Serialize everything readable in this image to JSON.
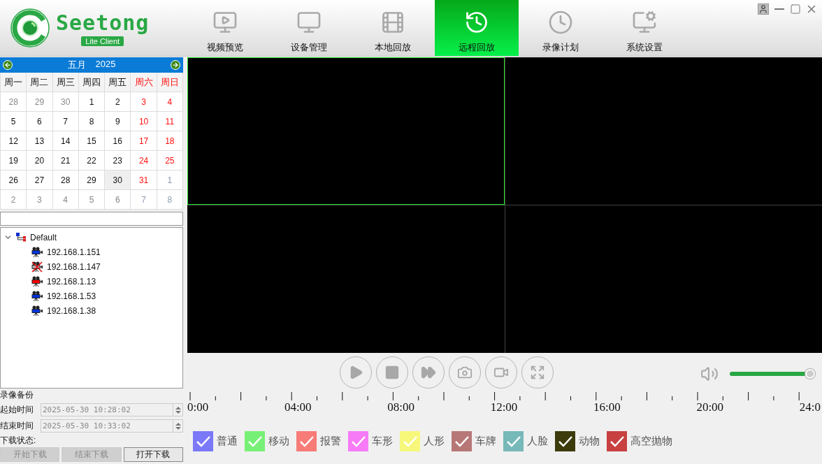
{
  "app": {
    "logo": "Seetong",
    "edition": "Lite Client"
  },
  "nav": [
    {
      "label": "视频预览",
      "selected": false
    },
    {
      "label": "设备管理",
      "selected": false
    },
    {
      "label": "本地回放",
      "selected": false
    },
    {
      "label": "远程回放",
      "selected": true
    },
    {
      "label": "录像计划",
      "selected": false
    },
    {
      "label": "系统设置",
      "selected": false
    }
  ],
  "calendar": {
    "month": "五月",
    "year": "2025",
    "weekdays": [
      {
        "label": "周一",
        "weekend": false
      },
      {
        "label": "周二",
        "weekend": false
      },
      {
        "label": "周三",
        "weekend": false
      },
      {
        "label": "周四",
        "weekend": false
      },
      {
        "label": "周五",
        "weekend": false
      },
      {
        "label": "周六",
        "weekend": true
      },
      {
        "label": "周日",
        "weekend": true
      }
    ],
    "days": [
      {
        "label": "28",
        "muted": true,
        "weekend": false,
        "selected": false
      },
      {
        "label": "29",
        "muted": true,
        "weekend": false,
        "selected": false
      },
      {
        "label": "30",
        "muted": true,
        "weekend": false,
        "selected": false
      },
      {
        "label": "1",
        "muted": false,
        "weekend": false,
        "selected": false
      },
      {
        "label": "2",
        "muted": false,
        "weekend": false,
        "selected": false
      },
      {
        "label": "3",
        "muted": false,
        "weekend": true,
        "selected": false
      },
      {
        "label": "4",
        "muted": false,
        "weekend": true,
        "selected": false
      },
      {
        "label": "5",
        "muted": false,
        "weekend": false,
        "selected": false
      },
      {
        "label": "6",
        "muted": false,
        "weekend": false,
        "selected": false
      },
      {
        "label": "7",
        "muted": false,
        "weekend": false,
        "selected": false
      },
      {
        "label": "8",
        "muted": false,
        "weekend": false,
        "selected": false
      },
      {
        "label": "9",
        "muted": false,
        "weekend": false,
        "selected": false
      },
      {
        "label": "10",
        "muted": false,
        "weekend": true,
        "selected": false
      },
      {
        "label": "11",
        "muted": false,
        "weekend": true,
        "selected": false
      },
      {
        "label": "12",
        "muted": false,
        "weekend": false,
        "selected": false
      },
      {
        "label": "13",
        "muted": false,
        "weekend": false,
        "selected": false
      },
      {
        "label": "14",
        "muted": false,
        "weekend": false,
        "selected": false
      },
      {
        "label": "15",
        "muted": false,
        "weekend": false,
        "selected": false
      },
      {
        "label": "16",
        "muted": false,
        "weekend": false,
        "selected": false
      },
      {
        "label": "17",
        "muted": false,
        "weekend": true,
        "selected": false
      },
      {
        "label": "18",
        "muted": false,
        "weekend": true,
        "selected": false
      },
      {
        "label": "19",
        "muted": false,
        "weekend": false,
        "selected": false
      },
      {
        "label": "20",
        "muted": false,
        "weekend": false,
        "selected": false
      },
      {
        "label": "21",
        "muted": false,
        "weekend": false,
        "selected": false
      },
      {
        "label": "22",
        "muted": false,
        "weekend": false,
        "selected": false
      },
      {
        "label": "23",
        "muted": false,
        "weekend": false,
        "selected": false
      },
      {
        "label": "24",
        "muted": false,
        "weekend": true,
        "selected": false
      },
      {
        "label": "25",
        "muted": false,
        "weekend": true,
        "selected": false
      },
      {
        "label": "26",
        "muted": false,
        "weekend": false,
        "selected": false
      },
      {
        "label": "27",
        "muted": false,
        "weekend": false,
        "selected": false
      },
      {
        "label": "28",
        "muted": false,
        "weekend": false,
        "selected": false
      },
      {
        "label": "29",
        "muted": false,
        "weekend": false,
        "selected": false
      },
      {
        "label": "30",
        "muted": false,
        "weekend": false,
        "selected": true
      },
      {
        "label": "31",
        "muted": false,
        "weekend": true,
        "selected": false
      },
      {
        "label": "1",
        "muted": true,
        "weekend": true,
        "selected": false
      },
      {
        "label": "2",
        "muted": true,
        "weekend": false,
        "selected": false
      },
      {
        "label": "3",
        "muted": true,
        "weekend": false,
        "selected": false
      },
      {
        "label": "4",
        "muted": true,
        "weekend": false,
        "selected": false
      },
      {
        "label": "5",
        "muted": true,
        "weekend": false,
        "selected": false
      },
      {
        "label": "6",
        "muted": true,
        "weekend": false,
        "selected": false
      },
      {
        "label": "7",
        "muted": true,
        "weekend": true,
        "selected": false
      },
      {
        "label": "8",
        "muted": true,
        "weekend": true,
        "selected": false
      }
    ]
  },
  "device_tree": [
    {
      "label": "Default",
      "expanded": true,
      "children": [
        {
          "label": "192.168.1.151",
          "kind": "online"
        },
        {
          "label": "192.168.1.147",
          "kind": "offline"
        },
        {
          "label": "192.168.1.13",
          "kind": "alarm"
        },
        {
          "label": "192.168.1.53",
          "kind": "online"
        },
        {
          "label": "192.168.1.38",
          "kind": "online"
        }
      ]
    }
  ],
  "backup": {
    "title": "录像备份",
    "fields": [
      {
        "label": "起始时间",
        "value": "2025-05-30 10:28:02"
      },
      {
        "label": "结束时间",
        "value": "2025-05-30 10:33:02"
      }
    ],
    "status_label": "下载状态:",
    "buttons": [
      {
        "label": "开始下载",
        "disabled": true
      },
      {
        "label": "结束下载",
        "disabled": true
      },
      {
        "label": "打开下载",
        "disabled": false
      }
    ]
  },
  "video_panes": [
    {
      "selected": true
    },
    {
      "selected": false
    },
    {
      "selected": false
    },
    {
      "selected": false
    }
  ],
  "volume": {
    "level": 1.0
  },
  "timeline": {
    "labels": [
      "0:00",
      "04:00",
      "08:00",
      "12:00",
      "16:00",
      "20:00",
      "24:0"
    ]
  },
  "record_types": [
    {
      "label": "普通",
      "color": "#7b79f7",
      "checked": true
    },
    {
      "label": "移动",
      "color": "#77f077",
      "checked": true
    },
    {
      "label": "报警",
      "color": "#f77b77",
      "checked": true
    },
    {
      "label": "车形",
      "color": "#f77bf7",
      "checked": true
    },
    {
      "label": "人形",
      "color": "#f7f77b",
      "checked": true
    },
    {
      "label": "车牌",
      "color": "#b87777",
      "checked": true
    },
    {
      "label": "人脸",
      "color": "#77b8b8",
      "checked": true
    },
    {
      "label": "动物",
      "color": "#3b3b0b",
      "checked": true
    },
    {
      "label": "高空抛物",
      "color": "#c84040",
      "checked": true
    }
  ]
}
